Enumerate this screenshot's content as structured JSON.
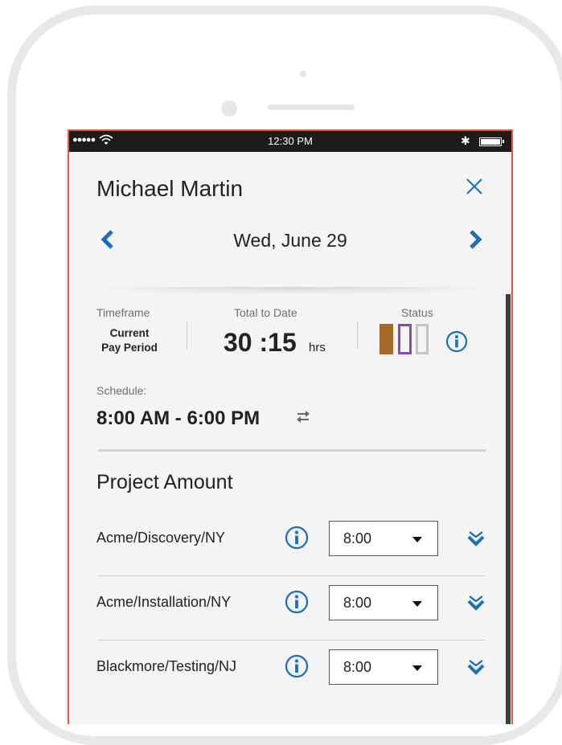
{
  "statusbar": {
    "signal": "●●●●●",
    "time": "12:30 PM",
    "bluetooth": "✱"
  },
  "header": {
    "employee_name": "Michael Martin",
    "date": "Wed, June 29"
  },
  "summary": {
    "timeframe_label": "Timeframe",
    "timeframe_line1": "Current",
    "timeframe_line2": "Pay Period",
    "total_label": "Total to Date",
    "total_value": "30 :15",
    "total_unit": "hrs",
    "status_label": "Status"
  },
  "schedule": {
    "label": "Schedule:",
    "value": "8:00 AM - 6:00 PM"
  },
  "projects": {
    "title": "Project Amount",
    "rows": [
      {
        "name": "Acme/Discovery/NY",
        "amount": "8:00"
      },
      {
        "name": "Acme/Installation/NY",
        "amount": "8:00"
      },
      {
        "name": "Blackmore/Testing/NJ",
        "amount": "8:00"
      }
    ]
  },
  "colors": {
    "accent": "#1a6ec0",
    "frame_border": "#e8583a",
    "status_filled": "#a5692a",
    "status_outline_purple": "#8d49a8",
    "status_outline_gray": "#c4c4c4"
  }
}
